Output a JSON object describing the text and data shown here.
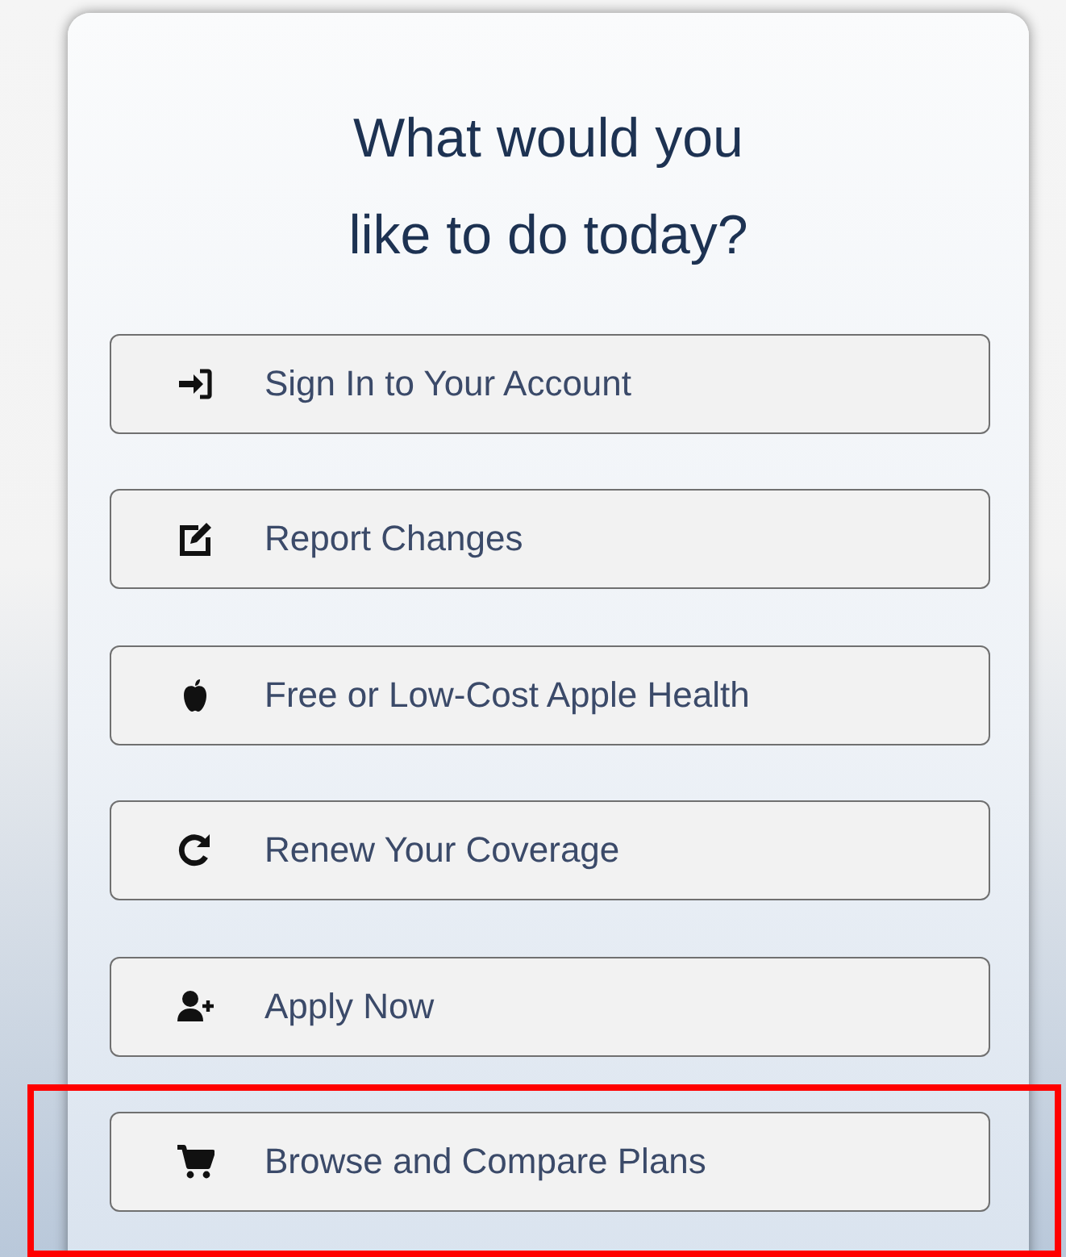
{
  "heading": {
    "lines": [
      "What would you",
      "like to do today?"
    ]
  },
  "actions": [
    {
      "label": "Sign In to Your Account",
      "kind": "sign-in",
      "highlighted": false
    },
    {
      "label": "Report Changes",
      "kind": "edit",
      "highlighted": false
    },
    {
      "label": "Free or Low-Cost Apple Health",
      "kind": "apple",
      "highlighted": false
    },
    {
      "label": "Renew Your Coverage",
      "kind": "redo",
      "highlighted": false
    },
    {
      "label": "Apply Now",
      "kind": "user-plus",
      "highlighted": false
    },
    {
      "label": "Browse and Compare Plans",
      "kind": "cart",
      "highlighted": true
    }
  ]
}
